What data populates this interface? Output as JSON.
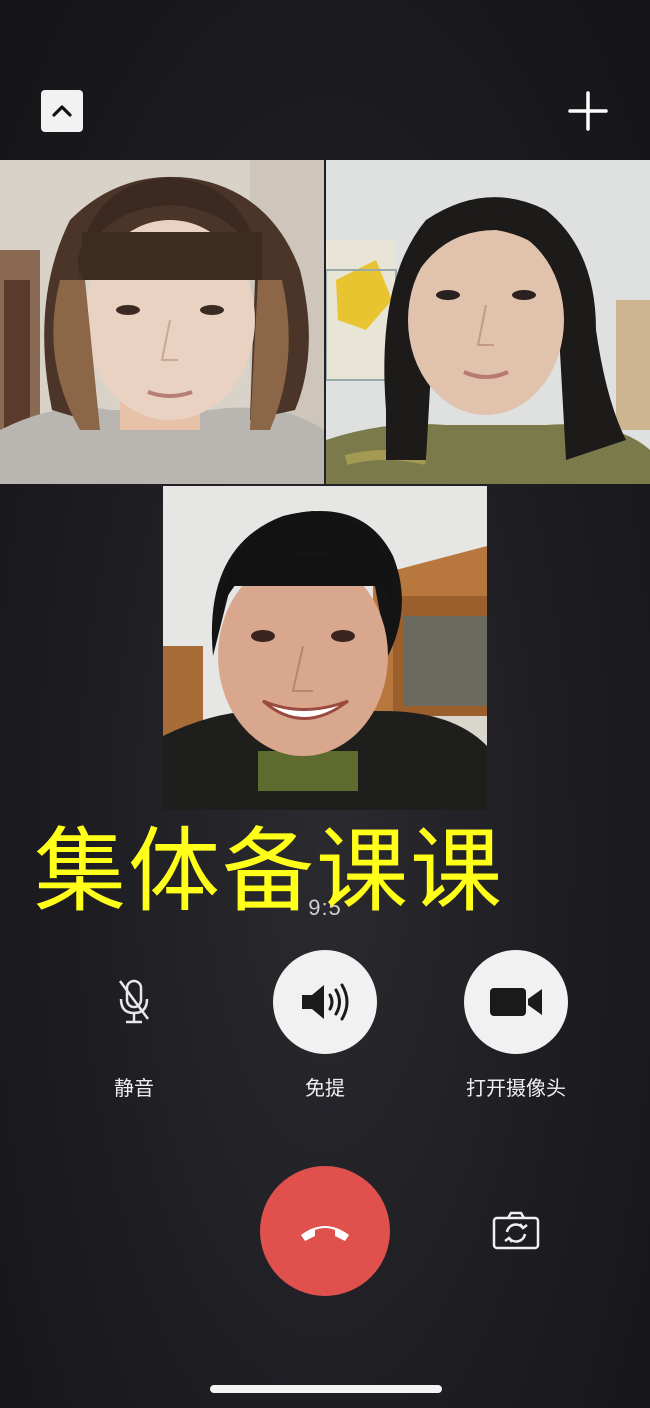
{
  "call": {
    "timer": "9:5"
  },
  "overlay": {
    "caption": "集体备课课",
    "color": "#ffff19"
  },
  "controls": {
    "mute_label": "静音",
    "speaker_label": "免提",
    "camera_label": "打开摄像头"
  },
  "icons": {
    "collapse": "chevron-up-icon",
    "add": "plus-icon",
    "mute": "microphone-off-icon",
    "speaker": "speaker-icon",
    "camera": "video-camera-icon",
    "hangup": "phone-hangup-icon",
    "switch_camera": "switch-camera-icon"
  },
  "colors": {
    "hangup": "#e0504c",
    "control_circle": "#f1f1f1",
    "background": "#1b1b20"
  },
  "participants": [
    {
      "tile": "participant-video-1"
    },
    {
      "tile": "participant-video-2"
    },
    {
      "tile": "participant-video-3"
    }
  ]
}
